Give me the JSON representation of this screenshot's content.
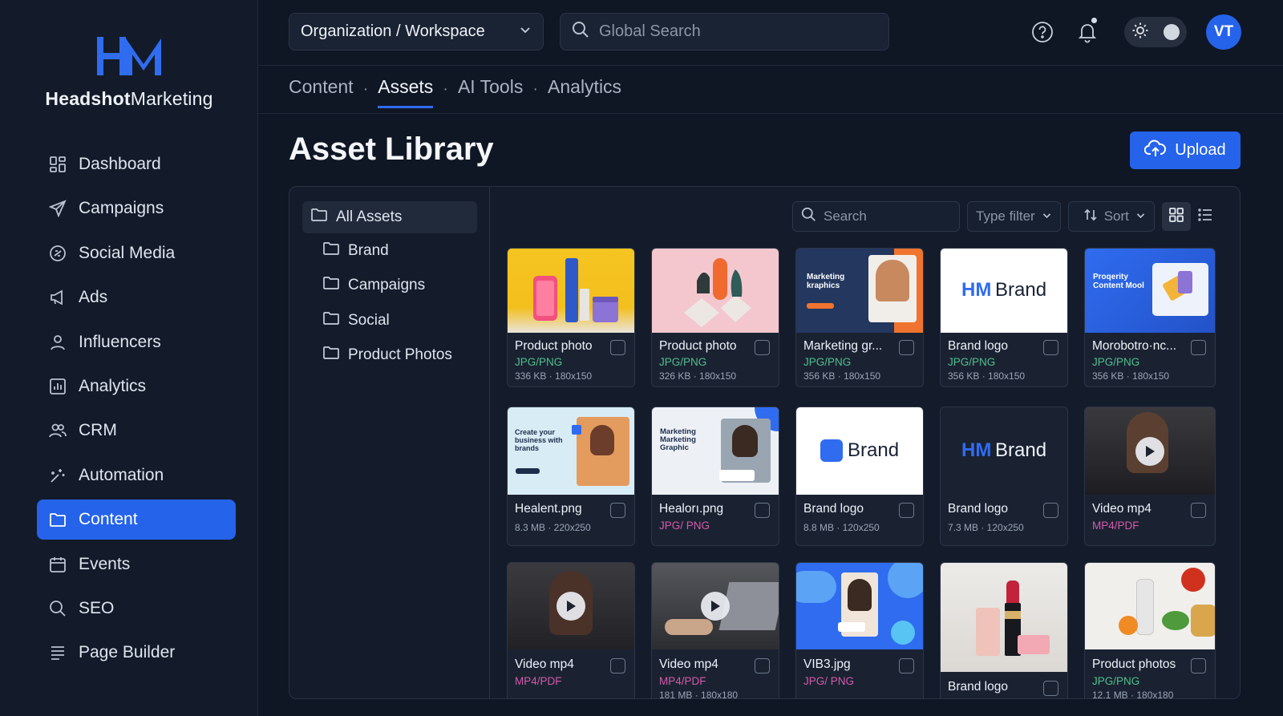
{
  "brand": {
    "name_bold": "Headshot",
    "name_rest": "Marketing",
    "colors": {
      "accent": "#2563eb",
      "logo": "#2f6cf0"
    }
  },
  "sidebar": {
    "items": [
      {
        "label": "Dashboard",
        "icon": "dashboard-icon"
      },
      {
        "label": "Campaigns",
        "icon": "send-icon"
      },
      {
        "label": "Social Media",
        "icon": "social-icon"
      },
      {
        "label": "Ads",
        "icon": "megaphone-icon"
      },
      {
        "label": "Influencers",
        "icon": "user-icon"
      },
      {
        "label": "Analytics",
        "icon": "bar-chart-icon"
      },
      {
        "label": "CRM",
        "icon": "users-icon"
      },
      {
        "label": "Automation",
        "icon": "automation-icon"
      },
      {
        "label": "Content",
        "icon": "folder-icon",
        "active": true
      },
      {
        "label": "Events",
        "icon": "calendar-icon"
      },
      {
        "label": "SEO",
        "icon": "search-icon"
      },
      {
        "label": "Page Builder",
        "icon": "page-builder-icon"
      }
    ]
  },
  "topbar": {
    "workspace": "Organization / Workspace",
    "search_placeholder": "Global Search",
    "avatar_initials": "VT"
  },
  "tabs": [
    {
      "label": "Content"
    },
    {
      "label": "Assets",
      "active": true
    },
    {
      "label": "AI Tools"
    },
    {
      "label": "Analytics"
    }
  ],
  "page": {
    "title": "Asset Library",
    "upload_label": "Upload"
  },
  "folders": {
    "root": "All Assets",
    "children": [
      "Brand",
      "Campaigns",
      "Social",
      "Product Photos"
    ]
  },
  "toolbar": {
    "search_placeholder": "Search",
    "type_filter": "Type filter",
    "sort": "Sort"
  },
  "assets": [
    {
      "title": "Product photo",
      "type": "JPG/PNG",
      "meta": "336 KB · 180x150"
    },
    {
      "title": "Product photo",
      "type": "JPG/PNG",
      "meta": "326 KB · 180x150"
    },
    {
      "title": "Marketing gr...",
      "type": "JPG/PNG",
      "meta": "356 KB · 180x150",
      "thumb_text": "Marketing kraphics"
    },
    {
      "title": "Brand logo",
      "type": "JPG/PNG",
      "meta": "356 KB · 180x150",
      "thumb_text": "Brand"
    },
    {
      "title": "Morobotro·nc...",
      "type": "JPG/PNG",
      "meta": "356 KB · 180x150",
      "thumb_text": "Proqerity Content Mool"
    },
    {
      "title": "Healent.png",
      "type": "",
      "meta": "8.3 MB · 220x250",
      "thumb_text": "Create your business with brands"
    },
    {
      "title": "Healorı.png",
      "type": "JPG/ PNG",
      "meta": "",
      "thumb_text": "Marketing Marketing Graphic"
    },
    {
      "title": "Brand logo",
      "type": "",
      "meta": "8.8 MB · 120x250",
      "thumb_text": "Brand"
    },
    {
      "title": "Brand logo",
      "type": "",
      "meta": "7.3 MB · 120x250",
      "thumb_text": "Brand"
    },
    {
      "title": "Video mp4",
      "type": "MP4/PDF",
      "meta": ""
    },
    {
      "title": "Video mp4",
      "type": "MP4/PDF",
      "meta": ""
    },
    {
      "title": "Video mp4",
      "type": "MP4/PDF",
      "meta": "181 MB · 180x180"
    },
    {
      "title": "VIB3.jpg",
      "type": "JPG/ PNG",
      "meta": ""
    },
    {
      "title": "Brand logo",
      "type": "",
      "meta": ""
    },
    {
      "title": "Product photos",
      "type": "JPG/PNG",
      "meta": "12.1 MB · 180x180"
    }
  ]
}
